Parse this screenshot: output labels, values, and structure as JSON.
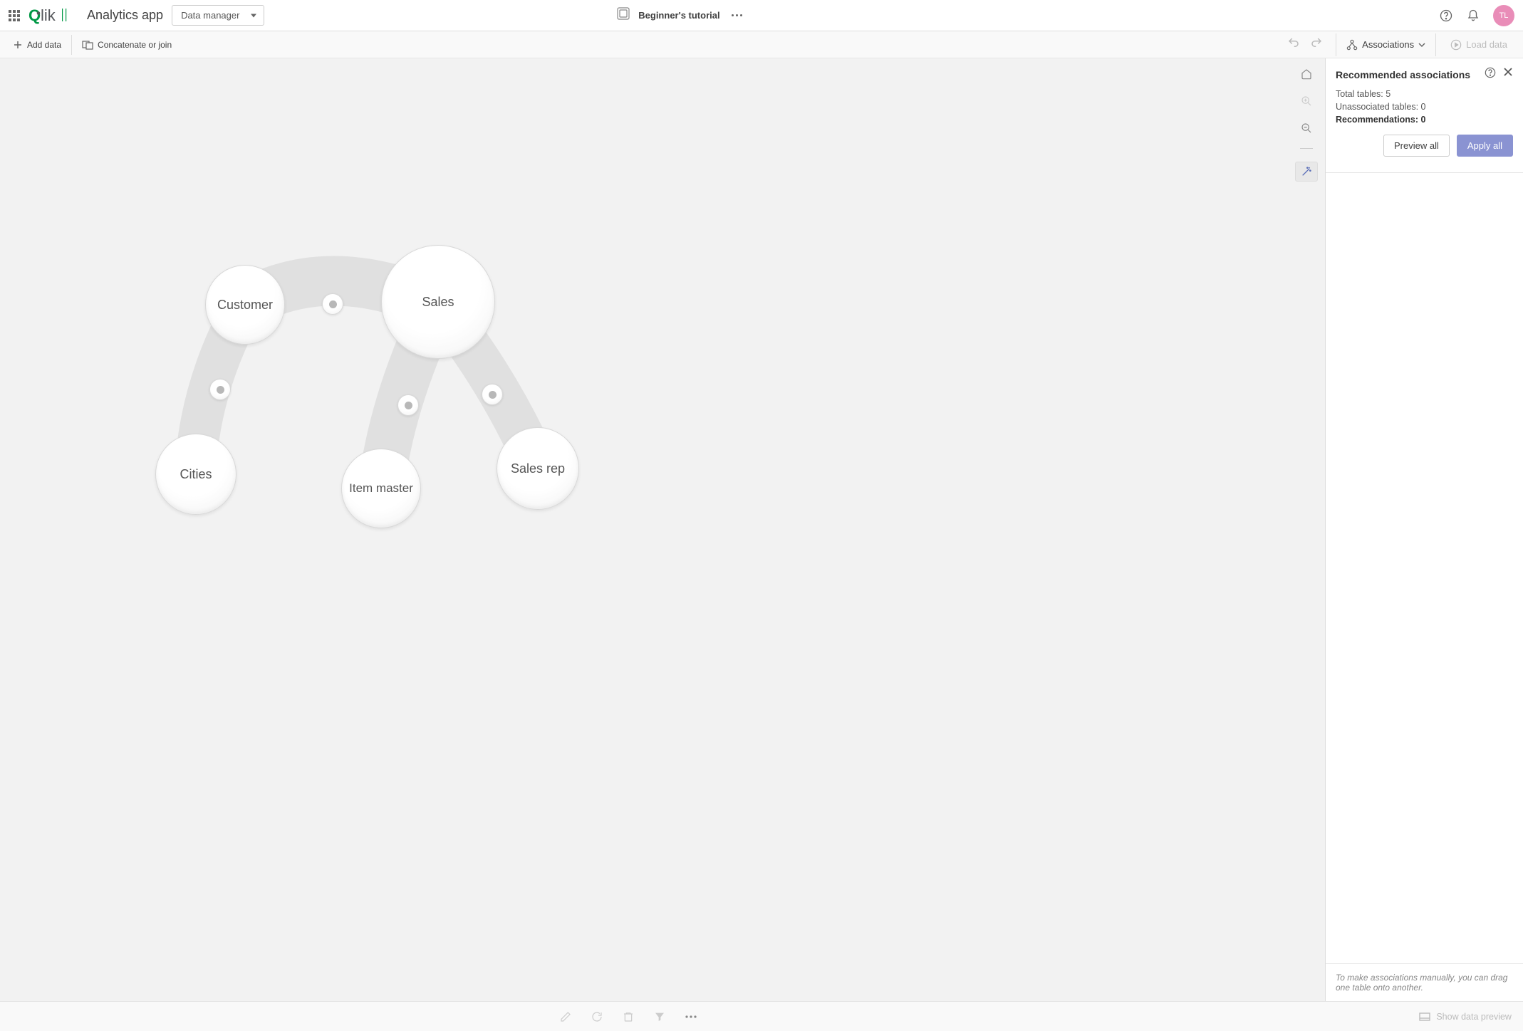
{
  "header": {
    "app_name": "Analytics app",
    "view_dropdown": "Data manager",
    "title": "Beginner's tutorial",
    "avatar_initials": "TL"
  },
  "secondary": {
    "add_data": "Add data",
    "concat": "Concatenate or join",
    "associations": "Associations",
    "load_data": "Load data"
  },
  "canvas": {
    "bubbles": {
      "customer": "Customer",
      "sales": "Sales",
      "cities": "Cities",
      "item_master": "Item master",
      "sales_rep": "Sales rep"
    }
  },
  "sidebar": {
    "title": "Recommended associations",
    "total_tables_label": "Total tables:",
    "total_tables_value": "5",
    "unassoc_label": "Unassociated tables:",
    "unassoc_value": "0",
    "recomm_label": "Recommendations:",
    "recomm_value": "0",
    "preview": "Preview all",
    "apply": "Apply all",
    "footer": "To make associations manually, you can drag one table onto another."
  },
  "bottom": {
    "show_preview": "Show data preview"
  }
}
